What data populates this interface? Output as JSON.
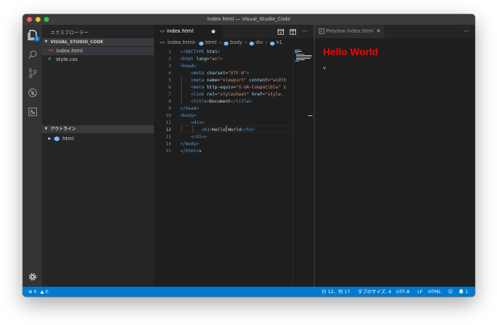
{
  "window": {
    "title": "index.html — Visual_Studio_Code"
  },
  "activity_bar": {
    "items": [
      {
        "name": "explorer-icon",
        "badge": "1"
      },
      {
        "name": "search-icon"
      },
      {
        "name": "source-control-icon"
      },
      {
        "name": "debug-icon"
      },
      {
        "name": "extensions-icon"
      }
    ],
    "bottom": {
      "name": "settings-gear-icon"
    }
  },
  "sidebar": {
    "title": "エクスプローラー",
    "folder": {
      "label": "VISUAL_STUDIO_CODE",
      "expanded": true
    },
    "files": [
      {
        "icon": "<>",
        "name": "index.html",
        "active": true,
        "icon_color": "#e37933"
      },
      {
        "icon": "#",
        "name": "style.css",
        "active": false,
        "icon_color": "#519aba"
      }
    ],
    "outline": {
      "label": "アウトライン",
      "items": [
        {
          "name": "html"
        }
      ]
    }
  },
  "editor": {
    "tab": {
      "icon": "<>",
      "label": "index.html",
      "dirty": true
    },
    "breadcrumbs": [
      "index.html",
      "html",
      "body",
      "div",
      "h1"
    ],
    "current_line": 12,
    "lines": [
      [
        {
          "t": "tag",
          "v": "<!DOCTYPE "
        },
        {
          "t": "attr",
          "v": "html"
        },
        {
          "t": "tag",
          "v": ">"
        }
      ],
      [
        {
          "t": "tag",
          "v": "<html "
        },
        {
          "t": "attr",
          "v": "lang"
        },
        {
          "t": "txt",
          "v": "="
        },
        {
          "t": "str",
          "v": "\"en\""
        },
        {
          "t": "tag",
          "v": ">"
        }
      ],
      [
        {
          "t": "tag",
          "v": "<head>"
        }
      ],
      [
        {
          "t": "txt",
          "v": "    "
        },
        {
          "t": "tag",
          "v": "<meta "
        },
        {
          "t": "attr",
          "v": "charset"
        },
        {
          "t": "txt",
          "v": "="
        },
        {
          "t": "str",
          "v": "\"UTF-8\""
        },
        {
          "t": "tag",
          "v": ">"
        }
      ],
      [
        {
          "t": "txt",
          "v": "    "
        },
        {
          "t": "tag",
          "v": "<meta "
        },
        {
          "t": "attr",
          "v": "name"
        },
        {
          "t": "txt",
          "v": "="
        },
        {
          "t": "str",
          "v": "\"viewport\""
        },
        {
          "t": "txt",
          "v": " "
        },
        {
          "t": "attr",
          "v": "content"
        },
        {
          "t": "txt",
          "v": "="
        },
        {
          "t": "str",
          "v": "\"width"
        }
      ],
      [
        {
          "t": "txt",
          "v": "    "
        },
        {
          "t": "tag",
          "v": "<meta "
        },
        {
          "t": "attr",
          "v": "http-equiv"
        },
        {
          "t": "txt",
          "v": "="
        },
        {
          "t": "str",
          "v": "\"X-UA-Compatible\""
        },
        {
          "t": "txt",
          "v": " c"
        }
      ],
      [
        {
          "t": "txt",
          "v": "    "
        },
        {
          "t": "tag",
          "v": "<link "
        },
        {
          "t": "attr",
          "v": "rel"
        },
        {
          "t": "txt",
          "v": "="
        },
        {
          "t": "str",
          "v": "\"stylesheet\""
        },
        {
          "t": "txt",
          "v": " "
        },
        {
          "t": "attr",
          "v": "href"
        },
        {
          "t": "txt",
          "v": "="
        },
        {
          "t": "str",
          "v": "\"style."
        }
      ],
      [
        {
          "t": "txt",
          "v": "    "
        },
        {
          "t": "tag",
          "v": "<title>"
        },
        {
          "t": "txt",
          "v": "Document"
        },
        {
          "t": "tag",
          "v": "</title>"
        }
      ],
      [
        {
          "t": "tag",
          "v": "</head>"
        }
      ],
      [
        {
          "t": "tag",
          "v": "<body>"
        }
      ],
      [
        {
          "t": "txt",
          "v": "    "
        },
        {
          "t": "tag",
          "v": "<div>"
        }
      ],
      [
        {
          "t": "txt",
          "v": "        "
        },
        {
          "t": "tag",
          "v": "<h1>"
        },
        {
          "t": "txt",
          "v": "Hello World"
        },
        {
          "t": "tag",
          "v": "</h1>"
        }
      ],
      [
        {
          "t": "txt",
          "v": "    "
        },
        {
          "t": "tag",
          "v": "</div>"
        }
      ],
      [
        {
          "t": "tag",
          "v": "</body>"
        }
      ],
      [
        {
          "t": "tag",
          "v": "</html>"
        },
        {
          "t": "txt",
          "v": "v"
        }
      ]
    ]
  },
  "preview": {
    "tab_label": "Preview index.html",
    "heading": "Hello World",
    "trailing_text": "v"
  },
  "status_bar": {
    "errors": "0",
    "warnings": "0",
    "position": "行 12、列 17",
    "tab_size": "タブのサイズ: 4",
    "encoding": "UTF-8",
    "eol": "LF",
    "language": "HTML",
    "notifications": "1"
  },
  "colors": {
    "accent": "#007acc",
    "heading": "#ff0000"
  }
}
